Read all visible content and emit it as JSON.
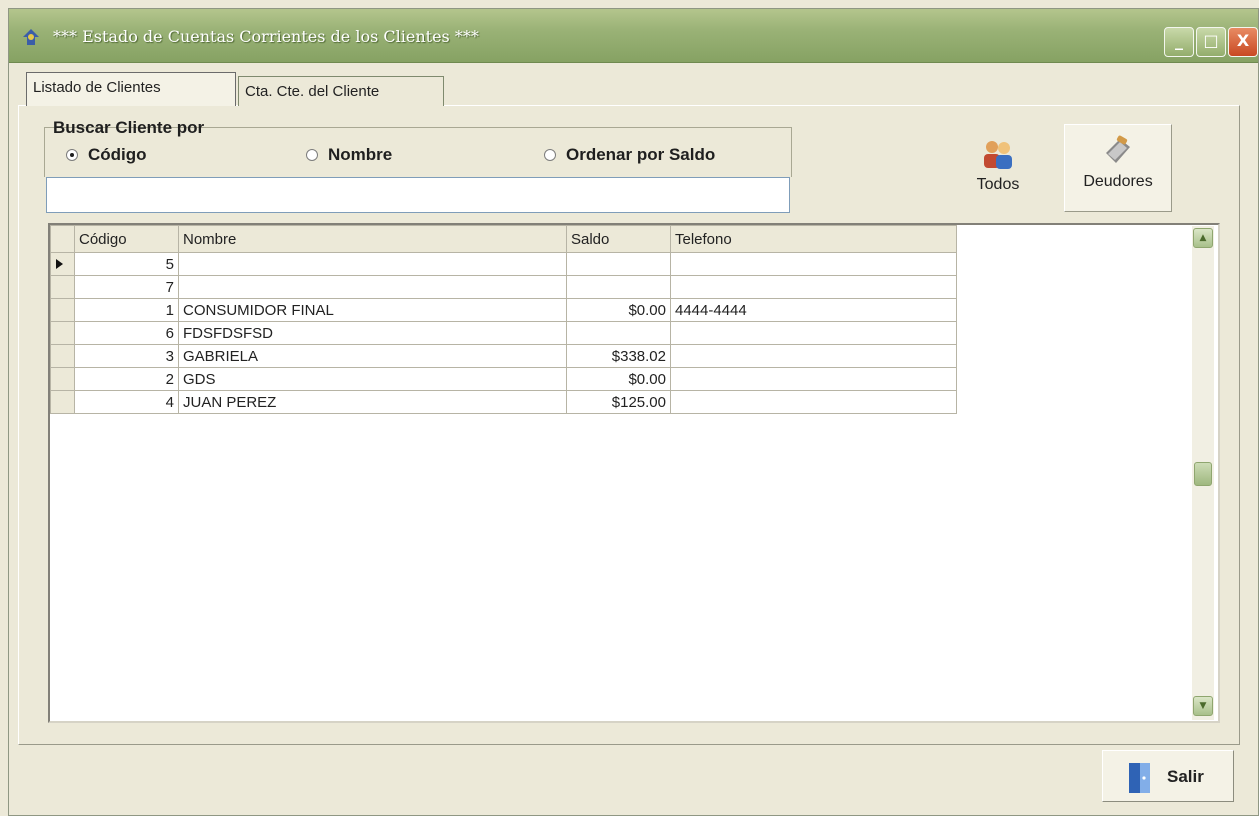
{
  "window": {
    "title": "*** Estado de Cuentas Corrientes de los Clientes ***",
    "controls": {
      "minimize": "_",
      "maximize": "□",
      "close": "X"
    }
  },
  "tabs": [
    {
      "label": "Listado de Clientes",
      "active": true
    },
    {
      "label": "Cta. Cte. del Cliente",
      "active": false
    }
  ],
  "search": {
    "group_label": "Buscar Cliente por",
    "options": [
      {
        "label": "Código",
        "checked": true
      },
      {
        "label": "Nombre",
        "checked": false
      },
      {
        "label": "Ordenar por Saldo",
        "checked": false
      }
    ],
    "value": ""
  },
  "toolbar": {
    "todos_label": "Todos",
    "deudores_label": "Deudores"
  },
  "grid": {
    "columns": [
      "Código",
      "Nombre",
      "Saldo",
      "Telefono"
    ],
    "rows": [
      {
        "codigo": "5",
        "nombre": "",
        "saldo": "",
        "telefono": "",
        "current": true
      },
      {
        "codigo": "7",
        "nombre": "",
        "saldo": "",
        "telefono": ""
      },
      {
        "codigo": "1",
        "nombre": "CONSUMIDOR FINAL",
        "saldo": "$0.00",
        "telefono": "4444-4444"
      },
      {
        "codigo": "6",
        "nombre": "FDSFDSFSD",
        "saldo": "",
        "telefono": ""
      },
      {
        "codigo": "3",
        "nombre": "GABRIELA",
        "saldo": "$338.02",
        "telefono": ""
      },
      {
        "codigo": "2",
        "nombre": "GDS",
        "saldo": "$0.00",
        "telefono": ""
      },
      {
        "codigo": "4",
        "nombre": "JUAN PEREZ",
        "saldo": "$125.00",
        "telefono": ""
      }
    ]
  },
  "footer": {
    "salir_label": "Salir"
  },
  "colors": {
    "titlebar": "#9ab276",
    "window_bg": "#ece9d8",
    "close_button": "#c94922"
  },
  "icons": [
    "app-icon",
    "users-icon",
    "wallet-icon",
    "exit-door-icon"
  ]
}
